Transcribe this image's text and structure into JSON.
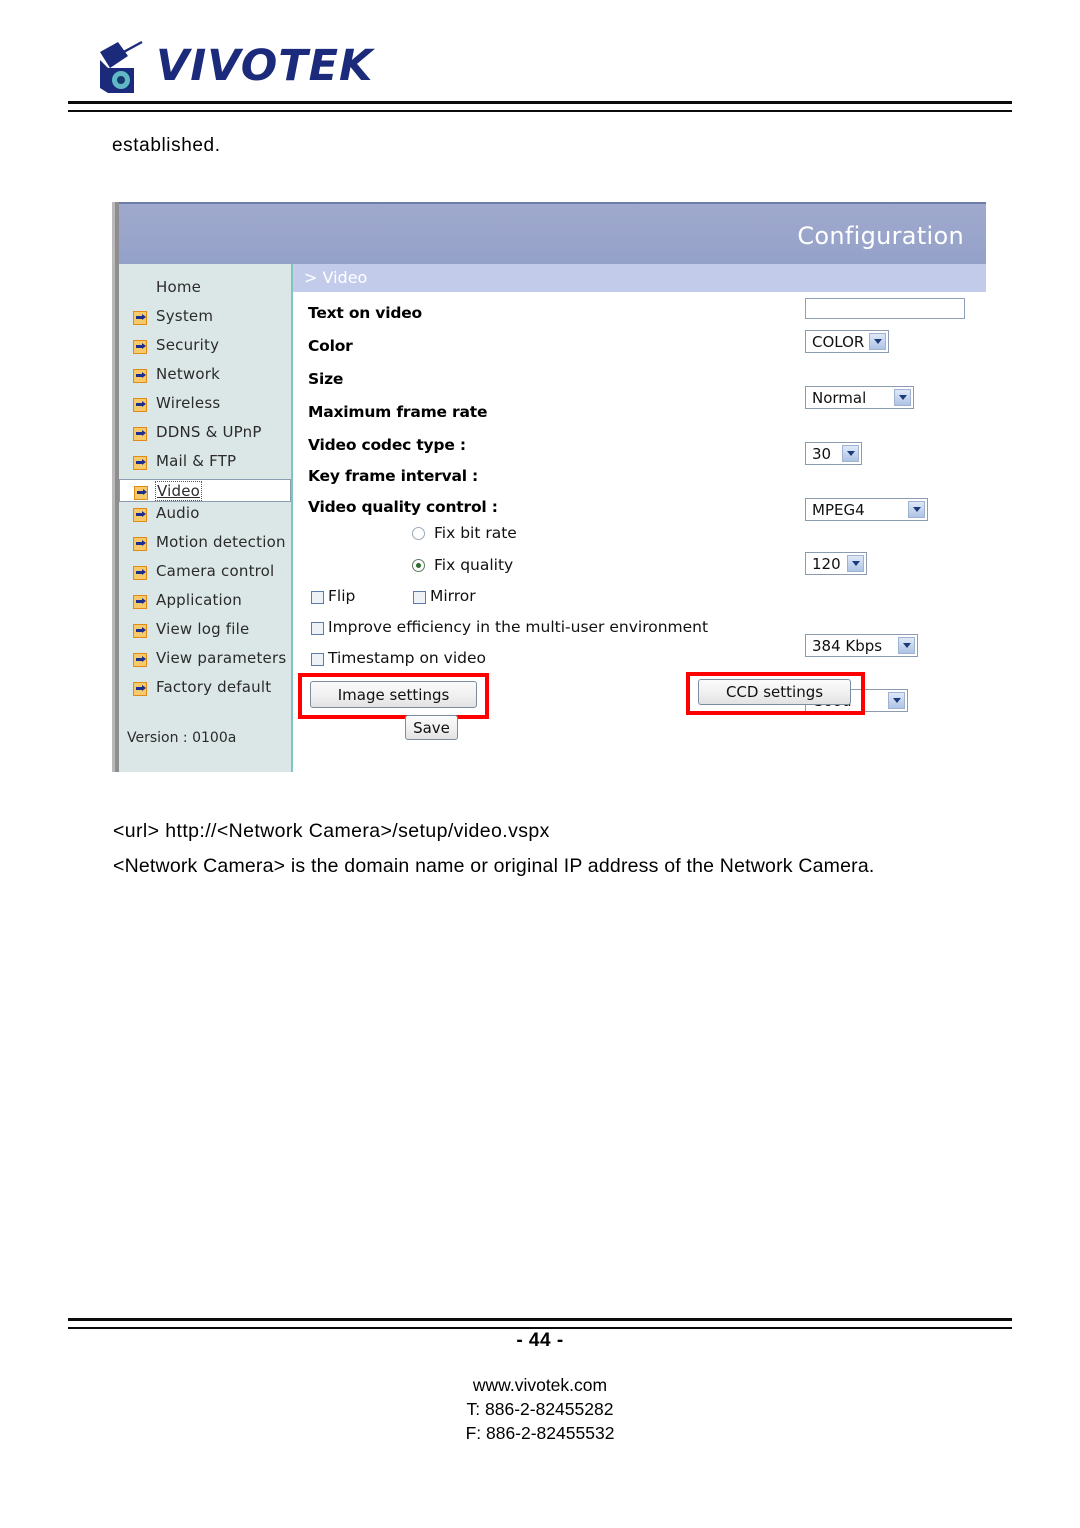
{
  "header": {
    "brand": "VIVOTEK",
    "logo_icon": "vivotek-camera-logo"
  },
  "document": {
    "intro_text": "established.",
    "url_line": "<url> http://<Network Camera>/setup/video.vspx",
    "note_line": "<Network Camera> is the domain name or original IP address of the Network Camera.",
    "page_number": "- 44 -",
    "footer": {
      "website": "www.vivotek.com",
      "tel": "T: 886-2-82455282",
      "fax": "F: 886-2-82455532"
    }
  },
  "screenshot": {
    "title": "Configuration",
    "breadcrumb": "> Video",
    "sidebar": {
      "items": [
        {
          "label": "Home",
          "bullet": false,
          "selected": false
        },
        {
          "label": "System",
          "bullet": true,
          "selected": false
        },
        {
          "label": "Security",
          "bullet": true,
          "selected": false
        },
        {
          "label": "Network",
          "bullet": true,
          "selected": false
        },
        {
          "label": "Wireless",
          "bullet": true,
          "selected": false
        },
        {
          "label": "DDNS & UPnP",
          "bullet": true,
          "selected": false
        },
        {
          "label": "Mail & FTP",
          "bullet": true,
          "selected": false
        },
        {
          "label": "Video",
          "bullet": true,
          "selected": true
        },
        {
          "label": "Audio",
          "bullet": true,
          "selected": false
        },
        {
          "label": "Motion detection",
          "bullet": true,
          "selected": false
        },
        {
          "label": "Camera control",
          "bullet": true,
          "selected": false
        },
        {
          "label": "Application",
          "bullet": true,
          "selected": false
        },
        {
          "label": "View log file",
          "bullet": true,
          "selected": false
        },
        {
          "label": "View parameters",
          "bullet": true,
          "selected": false
        },
        {
          "label": "Factory default",
          "bullet": true,
          "selected": false
        }
      ],
      "version": "Version : 0100a"
    },
    "form": {
      "text_on_video": {
        "label": "Text on video",
        "value": "",
        "placeholder": ""
      },
      "color": {
        "label": "Color",
        "value": "COLOR"
      },
      "size": {
        "label": "Size",
        "value": "Normal"
      },
      "max_frame_rate": {
        "label": "Maximum frame rate",
        "value": "30"
      },
      "codec": {
        "label": "Video codec type :",
        "value": "MPEG4"
      },
      "key_frame": {
        "label": "Key frame interval :",
        "value": "120"
      },
      "quality_control_label": "Video quality control :",
      "fix_bit_rate": {
        "label": "Fix bit rate",
        "selected": false,
        "value": "384 Kbps"
      },
      "fix_quality": {
        "label": "Fix quality",
        "selected": true,
        "value": "Good"
      },
      "flip": {
        "label": "Flip",
        "checked": false
      },
      "mirror": {
        "label": "Mirror",
        "checked": false
      },
      "improve": {
        "label": "Improve efficiency in the multi-user environment",
        "checked": false
      },
      "timestamp": {
        "label": "Timestamp on video",
        "checked": false
      },
      "image_settings_button": "Image settings",
      "ccd_settings_button": "CCD settings",
      "save_button": "Save"
    },
    "colors": {
      "titlebar": "#9aa5cb",
      "breadcrumb": "#c2ccea",
      "sidebar": "#dbe7e6",
      "highlight": "#ff0000",
      "bullet": "#f6c96a"
    }
  }
}
